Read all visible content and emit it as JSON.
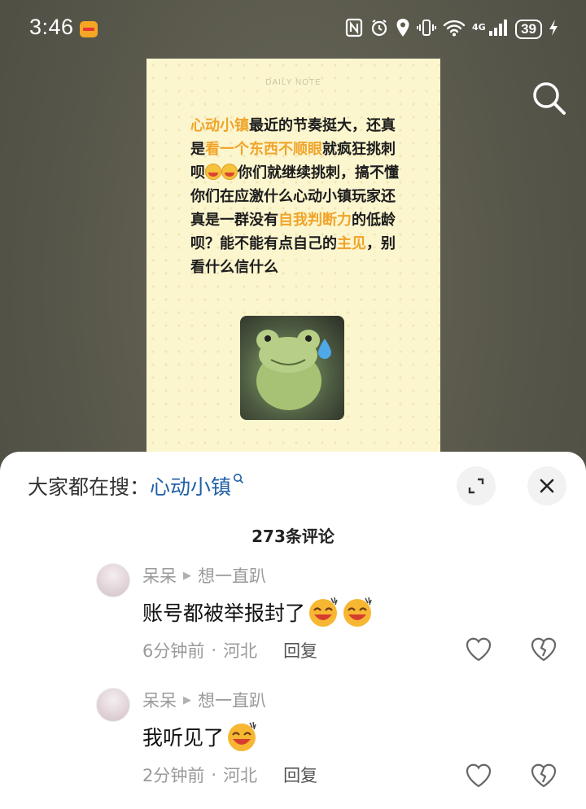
{
  "status_bar": {
    "time": "3:46",
    "network": "4G",
    "battery": "39",
    "icons": [
      "nfc-icon",
      "alarm-icon",
      "location-icon",
      "vibrate-icon",
      "wifi-icon",
      "signal-icon",
      "battery-icon",
      "charging-icon"
    ]
  },
  "note": {
    "heading": "DAILY NOTE",
    "segments": [
      {
        "text": "心动小镇",
        "highlight": true
      },
      {
        "text": "最近的节奏挺大，还真是",
        "highlight": false
      },
      {
        "text": "看一个东西不顺眼",
        "highlight": true
      },
      {
        "text": "就疯狂挑刺呗",
        "highlight": false
      },
      {
        "text": "你们就继续挑刺，搞不懂你们在应激什么心动小镇玩家还真是一群没有",
        "highlight": false
      },
      {
        "text": "自我判断力",
        "highlight": true
      },
      {
        "text": "的低龄呗？能不能有点自己的",
        "highlight": false
      },
      {
        "text": "主见",
        "highlight": true
      },
      {
        "text": "，别看什么信什么",
        "highlight": false
      }
    ]
  },
  "sheet": {
    "trending_label": "大家都在搜：",
    "trending_term": "心动小镇",
    "comment_count": "273条评论"
  },
  "comments": [
    {
      "user": "呆呆",
      "reply_to": "想一直趴",
      "text": "账号都被举报封了",
      "emoji_count": 2,
      "time": "6分钟前",
      "location": "河北",
      "reply_label": "回复"
    },
    {
      "user": "呆呆",
      "reply_to": "想一直趴",
      "text": "我听见了",
      "emoji_count": 1,
      "time": "2分钟前",
      "location": "河北",
      "reply_label": "回复"
    }
  ],
  "colors": {
    "highlight": "#f0a42a",
    "link": "#1f5fa8",
    "backdrop": "#5c5b4c"
  }
}
